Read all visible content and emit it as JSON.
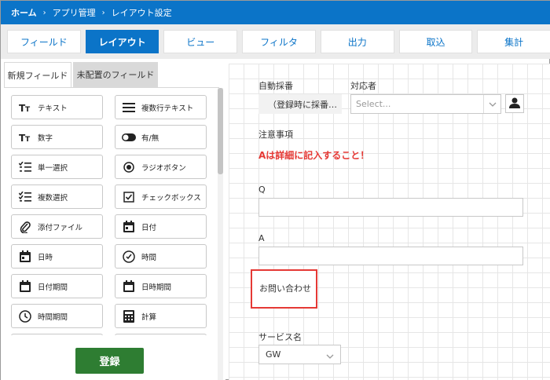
{
  "breadcrumb": [
    "ホーム",
    "アプリ管理",
    "レイアウト設定"
  ],
  "tabs": [
    {
      "label": "フィールド"
    },
    {
      "label": "レイアウト",
      "active": true
    },
    {
      "label": "ビュー"
    },
    {
      "label": "フィルタ"
    },
    {
      "label": "出力"
    },
    {
      "label": "取込"
    },
    {
      "label": "集計"
    }
  ],
  "subtabs": {
    "new": "新規フィールド",
    "unplaced": "未配置のフィールド"
  },
  "fields": [
    {
      "label": "テキスト",
      "icon": "text-icon"
    },
    {
      "label": "複数行テキスト",
      "icon": "multiline-text-icon"
    },
    {
      "label": "数字",
      "icon": "number-icon"
    },
    {
      "label": "有/無",
      "icon": "toggle-icon"
    },
    {
      "label": "単一選択",
      "icon": "single-select-icon"
    },
    {
      "label": "ラジオボタン",
      "icon": "radio-icon"
    },
    {
      "label": "複数選択",
      "icon": "multi-select-icon"
    },
    {
      "label": "チェックボックス",
      "icon": "checkbox-icon"
    },
    {
      "label": "添付ファイル",
      "icon": "attachment-icon"
    },
    {
      "label": "日付",
      "icon": "calendar-icon"
    },
    {
      "label": "日時",
      "icon": "calendar-icon"
    },
    {
      "label": "時間",
      "icon": "clock-icon"
    },
    {
      "label": "日付期間",
      "icon": "calendar-icon"
    },
    {
      "label": "日時期間",
      "icon": "calendar-icon"
    },
    {
      "label": "時間期間",
      "icon": "clock-period-icon"
    },
    {
      "label": "計算",
      "icon": "calculator-icon"
    }
  ],
  "register_label": "登録",
  "form": {
    "auto_number_label": "自動採番",
    "auto_number_value": "（登録時に採番…",
    "assignee_label": "対応者",
    "assignee_placeholder": "Select...",
    "notes_label": "注意事項",
    "notes_text": "Aは詳細に記入すること！",
    "q_label": "Q",
    "a_label": "A",
    "inquiry_label": "お問い合わせ",
    "service_label": "サービス名",
    "service_value": "GW"
  },
  "colors": {
    "primary": "#0b74c8",
    "register": "#2e7d32",
    "alert": "#e53935"
  }
}
